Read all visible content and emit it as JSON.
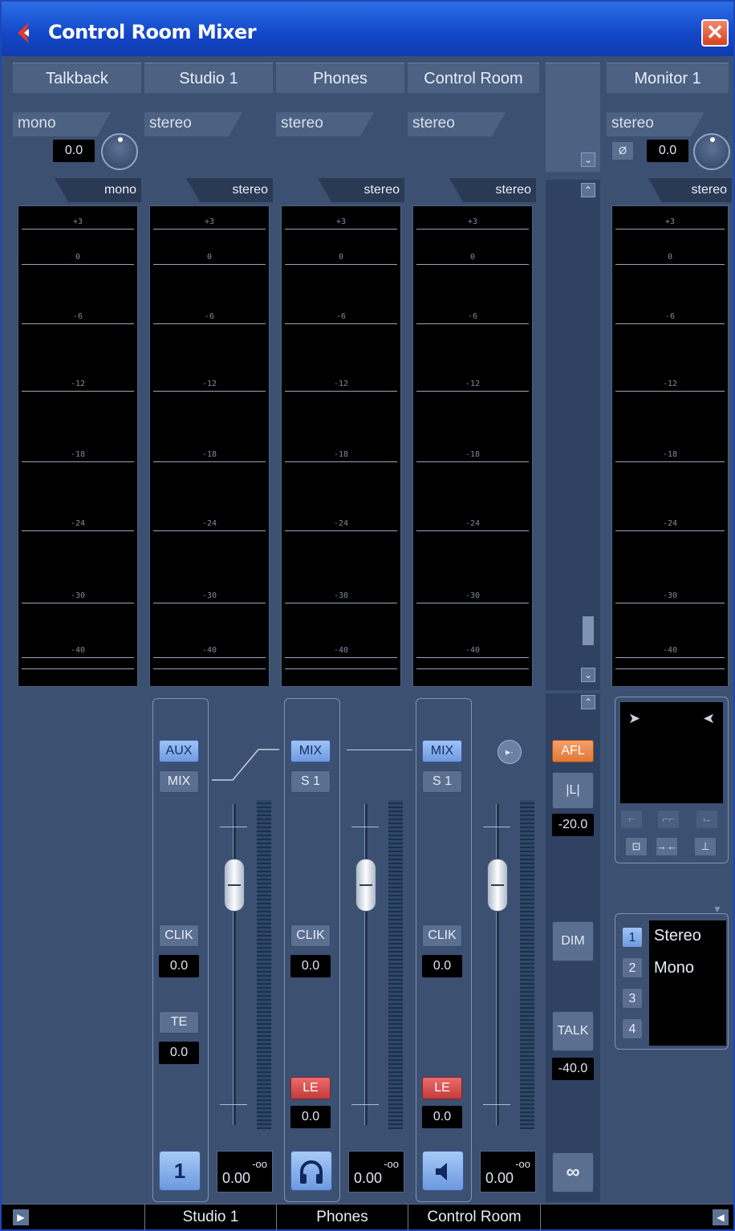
{
  "window": {
    "title": "Control Room Mixer",
    "close_icon": "close-icon"
  },
  "headers": [
    "Talkback",
    "Studio 1",
    "Phones",
    "Control Room",
    "Monitor 1"
  ],
  "formats": {
    "talkback": "mono",
    "studio1": "stereo",
    "phones": "stereo",
    "control_room": "stereo",
    "monitor1": "stereo"
  },
  "input_gain": {
    "talkback": "0.0",
    "monitor1": "0.0"
  },
  "meter_tabs": [
    "mono",
    "stereo",
    "stereo",
    "stereo",
    "stereo"
  ],
  "meter_scale": [
    "+3",
    "0",
    "-6",
    "-12",
    "-18",
    "-24",
    "-30",
    "-40"
  ],
  "studio1": {
    "aux": "AUX",
    "mix": "MIX",
    "clik": "CLIK",
    "clik_val": "0.0",
    "te": "TE",
    "te_val": "0.0",
    "channel_num": "1",
    "volume": "0.00",
    "peak": "-oo"
  },
  "phones": {
    "mix": "MIX",
    "s1": "S 1",
    "clik": "CLIK",
    "clik_val": "0.0",
    "le": "LE",
    "le_val": "0.0",
    "volume": "0.00",
    "peak": "-oo"
  },
  "control_room": {
    "mix": "MIX",
    "s1": "S 1",
    "clik": "CLIK",
    "clik_val": "0.0",
    "le": "LE",
    "le_val": "0.0",
    "volume": "0.00",
    "peak": "-oo"
  },
  "right_controls": {
    "afl": "AFL",
    "li": "|L|",
    "afl_val": "-20.0",
    "dim": "DIM",
    "talk": "TALK",
    "talk_val": "-40.0",
    "link": "∞"
  },
  "monitor_list": [
    {
      "num": "1",
      "name": "Stereo"
    },
    {
      "num": "2",
      "name": "Mono"
    },
    {
      "num": "3",
      "name": ""
    },
    {
      "num": "4",
      "name": ""
    }
  ],
  "status_bar": [
    "Studio 1",
    "Phones",
    "Control Room"
  ],
  "colors": {
    "accent_blue": "#7fa6e8",
    "red": "#d44a4a",
    "orange": "#e8863f",
    "panel": "#3c5071"
  }
}
